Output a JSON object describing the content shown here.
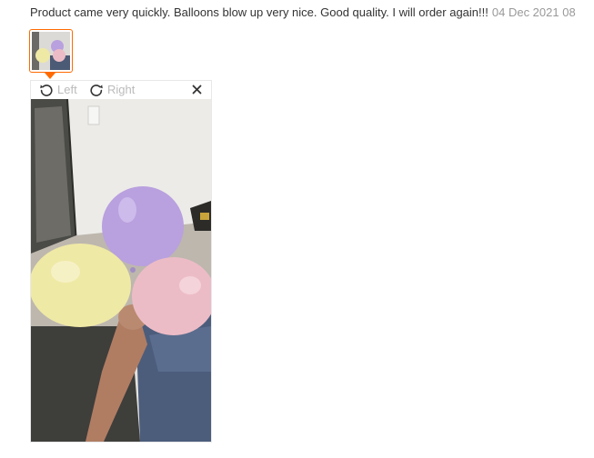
{
  "review": {
    "text": "Product came very quickly. Balloons blow up very nice. Good quality. I will order again!!!",
    "date": "04 Dec 2021 08"
  },
  "thumbnail": {
    "alt": "Review photo thumbnail"
  },
  "viewer": {
    "rotate_left_label": "Left",
    "rotate_right_label": "Right",
    "close_glyph": "×",
    "image_alt": "Photo of purple, yellow and pink balloons held by a hand"
  },
  "colors": {
    "accent": "#ff6a00",
    "text": "#333333",
    "muted": "#999999",
    "toolbar_text": "#bbbbbb",
    "balloon_purple": "#b9a0de",
    "balloon_yellow": "#efe9a6",
    "balloon_pink": "#ecbcc6"
  },
  "icons": {
    "rotate_left": "rotate-left-icon",
    "rotate_right": "rotate-right-icon",
    "close": "close-icon"
  }
}
